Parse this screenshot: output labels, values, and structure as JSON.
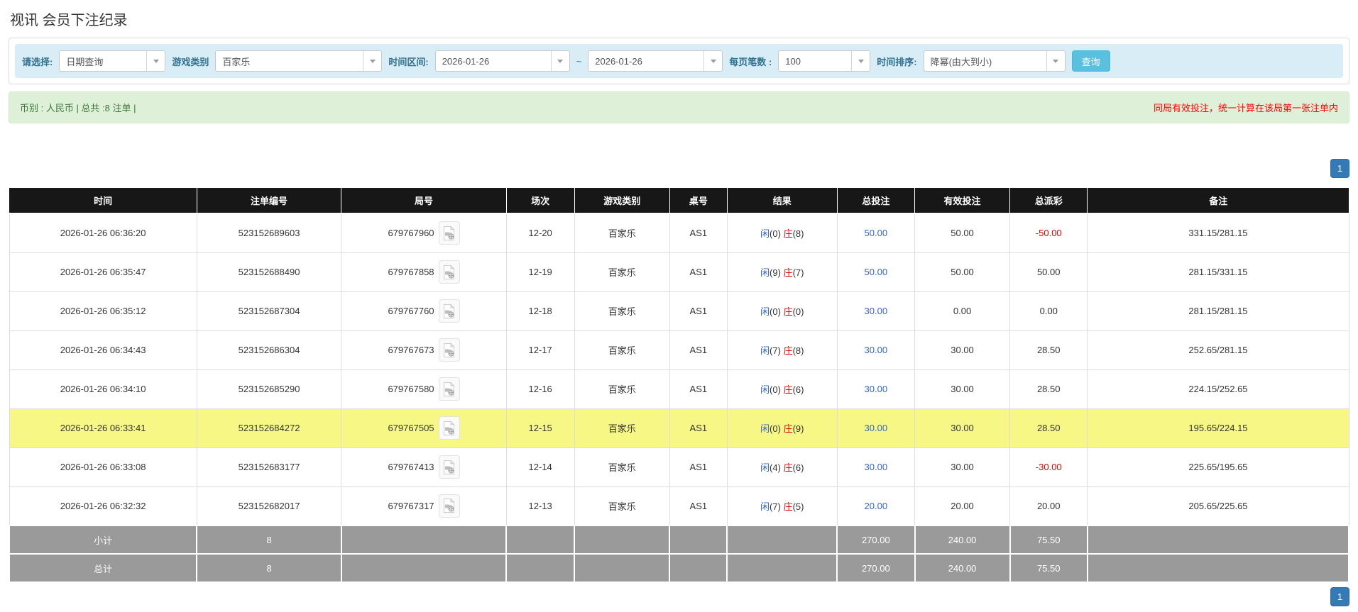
{
  "page": {
    "title": "视讯 会员下注纪录"
  },
  "filters": {
    "select_label": "请选择:",
    "select_value": "日期查询",
    "game_type_label": "游戏类别",
    "game_type_value": "百家乐",
    "time_range_label": "时间区间:",
    "date_from": "2026-01-26",
    "range_separator": "~",
    "date_to": "2026-01-26",
    "per_page_label": "每页笔数 :",
    "per_page_value": "100",
    "sort_label": "时间排序:",
    "sort_value": "降幂(由大到小)",
    "search_button": "查询"
  },
  "summary": {
    "left": "币别 : 人民币 | 总共 :8 注单 |",
    "right": "同局有效投注，统一计算在该局第一张注单内"
  },
  "pagination": {
    "page": "1"
  },
  "icons": {
    "combo_arrow": "caret-down-icon",
    "replay": "video-record-file-icon"
  },
  "colors": {
    "accent_blue": "#3366cc",
    "negative_red": "#e60000",
    "header_black": "#171717",
    "highlight_yellow": "#f7f786",
    "footer_gray": "#9a9a9a",
    "filter_strip_blue": "#d9edf7",
    "summary_green": "#dff0d8",
    "button_info": "#5bc0de",
    "pagination_blue": "#337ab7"
  },
  "table": {
    "headers": [
      "时间",
      "注单编号",
      "局号",
      "场次",
      "游戏类别",
      "桌号",
      "结果",
      "总投注",
      "有效投注",
      "总派彩",
      "备注"
    ],
    "col_widths": [
      "14%",
      "10.8%",
      "12.3%",
      "5.1%",
      "7.1%",
      "4.3%",
      "8.2%",
      "5.8%",
      "7.1%",
      "5.8%",
      "19.5%"
    ],
    "rows": [
      {
        "time": "2026-01-26 06:36:20",
        "bet_id": "523152689603",
        "round": "679767960",
        "session": "12-20",
        "game": "百家乐",
        "table_no": "AS1",
        "player": "闲",
        "player_pts": "(0)",
        "banker": "庄",
        "banker_pts": "(8)",
        "total_bet": "50.00",
        "valid_bet": "50.00",
        "payout": "-50.00",
        "remark": "331.15/281.15",
        "highlight": false
      },
      {
        "time": "2026-01-26 06:35:47",
        "bet_id": "523152688490",
        "round": "679767858",
        "session": "12-19",
        "game": "百家乐",
        "table_no": "AS1",
        "player": "闲",
        "player_pts": "(9)",
        "banker": "庄",
        "banker_pts": "(7)",
        "total_bet": "50.00",
        "valid_bet": "50.00",
        "payout": "50.00",
        "remark": "281.15/331.15",
        "highlight": false
      },
      {
        "time": "2026-01-26 06:35:12",
        "bet_id": "523152687304",
        "round": "679767760",
        "session": "12-18",
        "game": "百家乐",
        "table_no": "AS1",
        "player": "闲",
        "player_pts": "(0)",
        "banker": "庄",
        "banker_pts": "(0)",
        "total_bet": "30.00",
        "valid_bet": "0.00",
        "payout": "0.00",
        "remark": "281.15/281.15",
        "highlight": false
      },
      {
        "time": "2026-01-26 06:34:43",
        "bet_id": "523152686304",
        "round": "679767673",
        "session": "12-17",
        "game": "百家乐",
        "table_no": "AS1",
        "player": "闲",
        "player_pts": "(7)",
        "banker": "庄",
        "banker_pts": "(8)",
        "total_bet": "30.00",
        "valid_bet": "30.00",
        "payout": "28.50",
        "remark": "252.65/281.15",
        "highlight": false
      },
      {
        "time": "2026-01-26 06:34:10",
        "bet_id": "523152685290",
        "round": "679767580",
        "session": "12-16",
        "game": "百家乐",
        "table_no": "AS1",
        "player": "闲",
        "player_pts": "(0)",
        "banker": "庄",
        "banker_pts": "(6)",
        "total_bet": "30.00",
        "valid_bet": "30.00",
        "payout": "28.50",
        "remark": "224.15/252.65",
        "highlight": false
      },
      {
        "time": "2026-01-26 06:33:41",
        "bet_id": "523152684272",
        "round": "679767505",
        "session": "12-15",
        "game": "百家乐",
        "table_no": "AS1",
        "player": "闲",
        "player_pts": "(0)",
        "banker": "庄",
        "banker_pts": "(9)",
        "total_bet": "30.00",
        "valid_bet": "30.00",
        "payout": "28.50",
        "remark": "195.65/224.15",
        "highlight": true
      },
      {
        "time": "2026-01-26 06:33:08",
        "bet_id": "523152683177",
        "round": "679767413",
        "session": "12-14",
        "game": "百家乐",
        "table_no": "AS1",
        "player": "闲",
        "player_pts": "(4)",
        "banker": "庄",
        "banker_pts": "(6)",
        "total_bet": "30.00",
        "valid_bet": "30.00",
        "payout": "-30.00",
        "remark": "225.65/195.65",
        "highlight": false
      },
      {
        "time": "2026-01-26 06:32:32",
        "bet_id": "523152682017",
        "round": "679767317",
        "session": "12-13",
        "game": "百家乐",
        "table_no": "AS1",
        "player": "闲",
        "player_pts": "(7)",
        "banker": "庄",
        "banker_pts": "(5)",
        "total_bet": "20.00",
        "valid_bet": "20.00",
        "payout": "20.00",
        "remark": "205.65/225.65",
        "highlight": false
      }
    ],
    "footer": [
      {
        "label": "小计",
        "count": "8",
        "total_bet": "270.00",
        "valid_bet": "240.00",
        "payout": "75.50"
      },
      {
        "label": "总计",
        "count": "8",
        "total_bet": "270.00",
        "valid_bet": "240.00",
        "payout": "75.50"
      }
    ]
  }
}
